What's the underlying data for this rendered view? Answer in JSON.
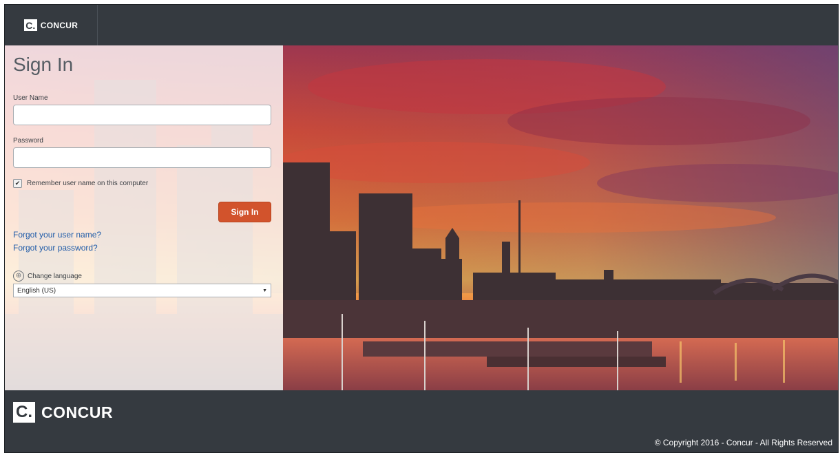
{
  "header": {
    "logo_mark": "C.",
    "logo_text": "CONCUR"
  },
  "signin": {
    "title": "Sign In",
    "username_label": "User Name",
    "username_value": "",
    "password_label": "Password",
    "password_value": "",
    "remember_checked": true,
    "remember_label": "Remember user name on this computer",
    "submit_label": "Sign In",
    "forgot_username": "Forgot your user name?",
    "forgot_password": "Forgot your password?",
    "change_language_label": "Change language",
    "language_selected": "English (US)"
  },
  "footer": {
    "logo_mark": "C.",
    "logo_text": "CONCUR",
    "copyright": "© Copyright 2016 - Concur - All Rights Reserved"
  },
  "colors": {
    "header_bg": "#353a40",
    "accent": "#d2532c",
    "link": "#1f5ba8"
  },
  "icons": [
    "globe-icon",
    "checkmark-icon",
    "caret-down-icon",
    "concur-logo"
  ]
}
